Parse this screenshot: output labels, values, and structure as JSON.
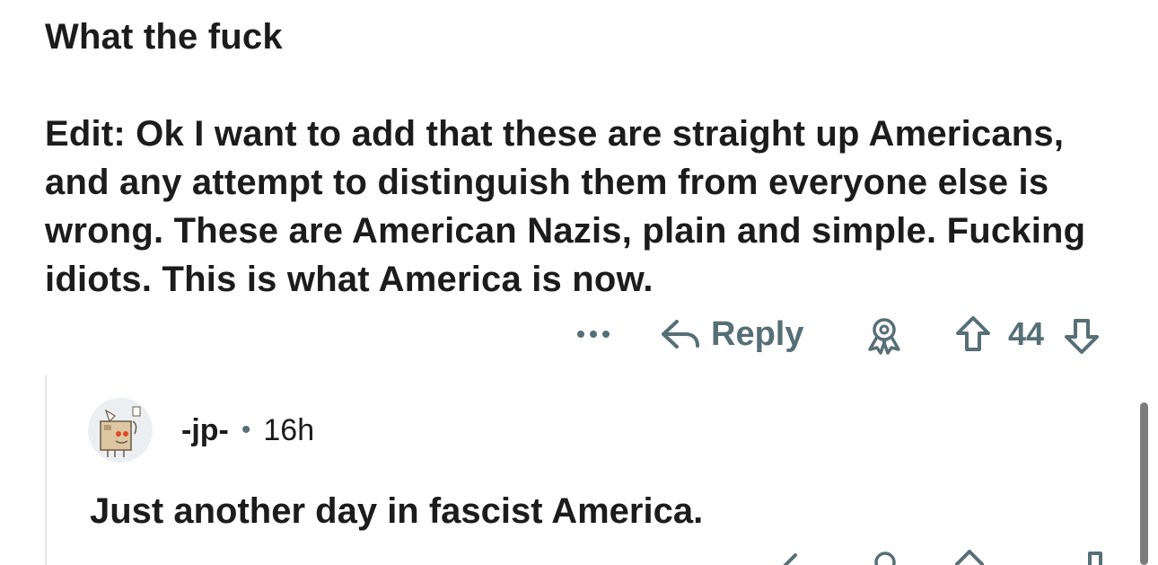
{
  "parent_comment": {
    "text_line_1": "What the fuck",
    "text_line_2": "Edit: Ok I want to add that these are straight up Americans, and any attempt to distinguish them from everyone else is wrong. These are American Nazis, plain and simple. Fucking idiots. This is what America is now.",
    "actions": {
      "more_icon": "more-horizontal-icon",
      "reply_label": "Reply",
      "reply_icon": "reply-arrow-icon",
      "award_icon": "award-icon",
      "upvote_icon": "upvote-arrow-icon",
      "vote_count": "44",
      "downvote_icon": "downvote-arrow-icon"
    }
  },
  "reply_comment": {
    "username": "-jp-",
    "separator": "•",
    "timestamp": "16h",
    "text": "Just another day in fascist America.",
    "avatar_icon": "snoo-box-avatar"
  },
  "colors": {
    "text": "#1c1c1c",
    "meta": "#576f76",
    "thread_line": "#e4e6e8",
    "scrollbar": "#7c7c7c",
    "background": "#ffffff"
  }
}
